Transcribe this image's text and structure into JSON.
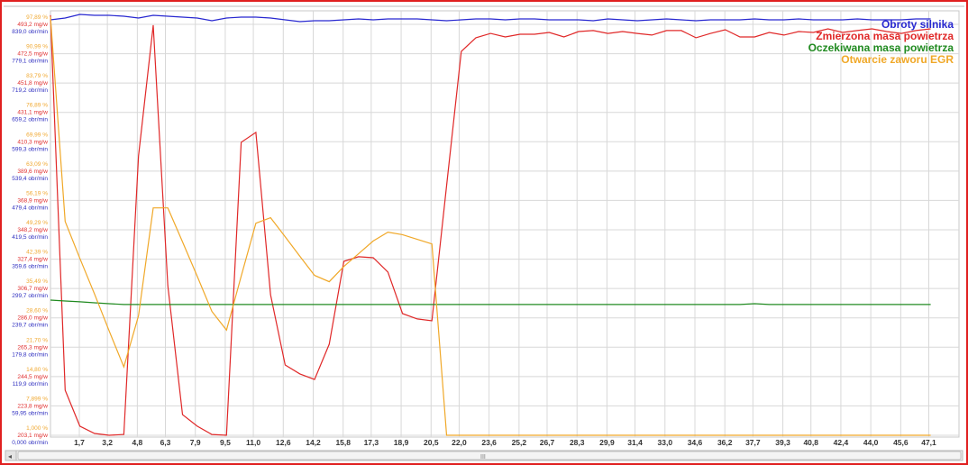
{
  "chart_data": {
    "type": "line",
    "title": "",
    "grid": true,
    "legend_position": "top-right",
    "x_ticks": [
      "1,7",
      "3,2",
      "4,8",
      "6,3",
      "7,9",
      "9,5",
      "11,0",
      "12,6",
      "14,2",
      "15,8",
      "17,3",
      "18,9",
      "20,5",
      "22,0",
      "23,6",
      "25,2",
      "26,7",
      "28,3",
      "29,9",
      "31,4",
      "33,0",
      "34,6",
      "36,2",
      "37,7",
      "39,3",
      "40,8",
      "42,4",
      "44,0",
      "45,6",
      "47,1"
    ],
    "xlim": [
      0.16,
      48.7
    ],
    "x_start": 0.16,
    "x_step": 0.784,
    "y_axes": [
      {
        "name": "pct",
        "color": "#f0a830",
        "labels": [
          "97,89 %",
          "90,99 %",
          "83,79 %",
          "76,89 %",
          "69,99 %",
          "63,09 %",
          "56,19 %",
          "49,29 %",
          "42,39 %",
          "35,49 %",
          "28,60 %",
          "21,70 %",
          "14,80 %",
          "7,899 %",
          "1,000 %"
        ],
        "range": [
          1.0,
          97.89
        ]
      },
      {
        "name": "mg",
        "color": "#e03030",
        "labels": [
          "493,2 mg/w",
          "472,5 mg/w",
          "451,8 mg/w",
          "431,1 mg/w",
          "410,3 mg/w",
          "389,6 mg/w",
          "368,9 mg/w",
          "348,2 mg/w",
          "327,4 mg/w",
          "306,7 mg/w",
          "286,0 mg/w",
          "265,3 mg/w",
          "244,5 mg/w",
          "223,8 mg/w",
          "203,1 mg/w"
        ],
        "range": [
          203.1,
          493.2
        ]
      },
      {
        "name": "rpm",
        "color": "#3030c0",
        "labels": [
          "839,0 obr/min",
          "779,1 obr/min",
          "719,2 obr/min",
          "659,2 obr/min",
          "599,3 obr/min",
          "539,4 obr/min",
          "479,4 obr/min",
          "419,5 obr/min",
          "359,6 obr/min",
          "299,7 obr/min",
          "239,7 obr/min",
          "179,8 obr/min",
          "119,9 obr/min",
          "59,95 obr/min",
          "0,000 obr/min"
        ],
        "range": [
          0,
          839.0
        ]
      }
    ],
    "series": [
      {
        "name": "Obroty silnika",
        "axis": "rpm",
        "color": "#2828d0",
        "values": [
          848.2,
          851.9,
          859.3,
          857.4,
          857.4,
          855.6,
          851.9,
          857.4,
          855.6,
          853.8,
          851.9,
          846.4,
          851.9,
          853.8,
          853.8,
          851.9,
          848.2,
          844.6,
          846.4,
          846.4,
          848.2,
          850.1,
          848.2,
          850.1,
          850.1,
          850.1,
          848.2,
          846.4,
          848.2,
          850.1,
          850.1,
          848.2,
          850.1,
          850.1,
          848.2,
          848.2,
          848.2,
          846.4,
          850.1,
          848.2,
          846.4,
          848.2,
          850.1,
          848.2,
          846.4,
          848.2,
          848.2,
          848.2,
          850.1,
          848.2,
          848.2,
          850.1,
          848.2,
          848.2,
          848.2,
          850.1,
          848.2,
          848.2,
          848.2,
          850.1,
          850.1
        ]
      },
      {
        "name": "Zmierzona masa powietrza",
        "axis": "mg",
        "color": "#e02828",
        "values": [
          499.6,
          234.9,
          209.5,
          204.4,
          203.1,
          203.7,
          400.3,
          492.6,
          308.7,
          217.7,
          209.5,
          203.7,
          203.1,
          409.9,
          416.9,
          302.3,
          252.7,
          246.4,
          242.5,
          267.4,
          325.9,
          329.1,
          328.4,
          318.3,
          289.0,
          285.2,
          283.9,
          379.3,
          474.1,
          483.7,
          486.8,
          484.3,
          486.2,
          486.2,
          487.5,
          484.3,
          488.1,
          488.8,
          486.8,
          488.1,
          486.8,
          485.6,
          488.8,
          488.8,
          483.7,
          486.8,
          489.4,
          484.3,
          484.3,
          487.5,
          485.6,
          488.1,
          487.5,
          490.0,
          487.5,
          488.8,
          490.0,
          488.1,
          486.8,
          488.8,
          490.0
        ]
      },
      {
        "name": "Oczekiwana masa powietrza",
        "axis": "mg",
        "color": "#208a20",
        "values": [
          298.5,
          297.9,
          297.3,
          296.6,
          296.0,
          295.4,
          295.4,
          295.4,
          295.4,
          295.4,
          295.4,
          295.4,
          295.4,
          295.4,
          295.4,
          295.4,
          295.4,
          295.4,
          295.4,
          295.4,
          295.4,
          295.4,
          295.4,
          295.4,
          295.4,
          295.4,
          295.4,
          295.4,
          295.4,
          295.4,
          295.4,
          295.4,
          295.4,
          295.4,
          295.4,
          295.4,
          295.4,
          295.4,
          295.4,
          295.4,
          295.4,
          295.4,
          295.4,
          295.4,
          295.4,
          295.4,
          295.4,
          295.4,
          296.0,
          295.4,
          295.4,
          295.4,
          295.4,
          295.4,
          295.4,
          295.4,
          295.4,
          295.4,
          295.4,
          295.4,
          295.4
        ]
      },
      {
        "name": "Otwarcie zaworu EGR",
        "axis": "pct",
        "color": "#f0a828",
        "values": [
          99.7,
          51.4,
          42.7,
          34.3,
          25.6,
          17.1,
          29.2,
          54.6,
          54.6,
          46.6,
          38.5,
          30.2,
          25.8,
          38.5,
          51.0,
          52.3,
          47.8,
          43.2,
          38.7,
          37.2,
          40.8,
          43.8,
          46.8,
          48.9,
          48.3,
          47.2,
          46.1,
          1.0,
          1.0,
          1.0,
          1.0,
          1.0,
          1.0,
          1.0,
          1.0,
          1.0,
          1.0,
          1.0,
          1.0,
          1.0,
          1.0,
          1.0,
          1.0,
          1.0,
          1.0,
          1.0,
          1.0,
          1.0,
          1.0,
          1.0,
          1.0,
          1.0,
          1.0,
          1.0,
          1.0,
          1.0,
          1.0,
          1.0,
          1.0,
          1.0,
          1.0
        ]
      }
    ]
  },
  "scrollbar": {
    "thumb_label": "III",
    "left_arrow": "◂"
  }
}
